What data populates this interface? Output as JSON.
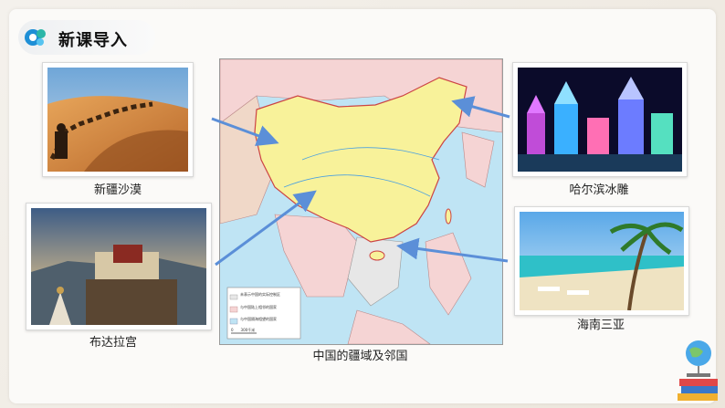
{
  "header": {
    "title": "新课导入"
  },
  "photos": [
    {
      "caption": "新疆沙漠"
    },
    {
      "caption": "布达拉宫"
    },
    {
      "caption": "哈尔滨冰雕"
    },
    {
      "caption": "海南三亚"
    }
  ],
  "map": {
    "caption": "中国的疆域及邻国",
    "legend": [
      "未表示中国的实际控制区",
      "与中国陆上相邻的国家",
      "与中国隔海相望的国家"
    ],
    "scale": "0　　300千米"
  },
  "colors": {
    "accent": "#1e8fd6",
    "china_fill": "#f8f29a",
    "sea": "#bfe4f4",
    "neighbor": "#f5d4d4",
    "arrow": "#5b8fd8"
  }
}
